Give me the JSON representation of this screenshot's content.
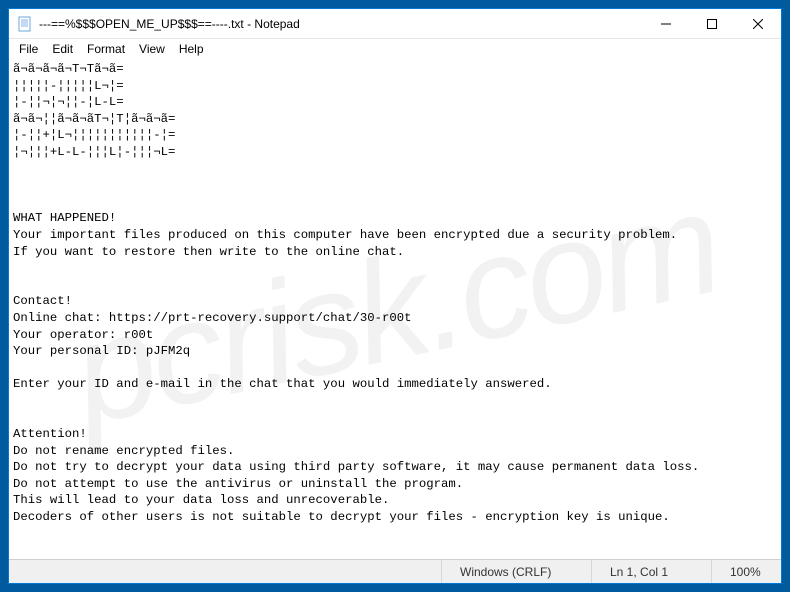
{
  "window": {
    "title": "---==%$$$OPEN_ME_UP$$$==----.txt - Notepad"
  },
  "menubar": {
    "items": [
      "File",
      "Edit",
      "Format",
      "View",
      "Help"
    ]
  },
  "content": {
    "text": "ã¬ã¬ã¬ã¬T¬Tã¬ã=\n¦¦¦¦¦-¦¦¦¦¦L¬¦=\n¦-¦¦¬¦¬¦¦-¦L-L=\nã¬ã¬¦¦ã¬ã¬ãT¬¦T¦ã¬ã¬ã=\n¦-¦¦+¦L¬¦¦¦¦¦¦¦¦¦¦¦-¦=\n¦¬¦¦¦+L-L-¦¦¦L¦-¦¦¦¬L=\n\n\n\nWHAT HAPPENED!\nYour important files produced on this computer have been encrypted due a security problem.\nIf you want to restore then write to the online chat.\n\n\nContact!\nOnline chat: https://prt-recovery.support/chat/30-r00t\nYour operator: r00t\nYour personal ID: pJFM2q\n\nEnter your ID and e-mail in the chat that you would immediately answered.\n\n\nAttention!\nDo not rename encrypted files.\nDo not try to decrypt your data using third party software, it may cause permanent data loss.\nDo not attempt to use the antivirus or uninstall the program.\nThis will lead to your data loss and unrecoverable.\nDecoders of other users is not suitable to decrypt your files - encryption key is unique."
  },
  "statusbar": {
    "encoding": "Windows (CRLF)",
    "position": "Ln 1, Col 1",
    "zoom": "100%"
  },
  "watermark": "pcrisk.com"
}
